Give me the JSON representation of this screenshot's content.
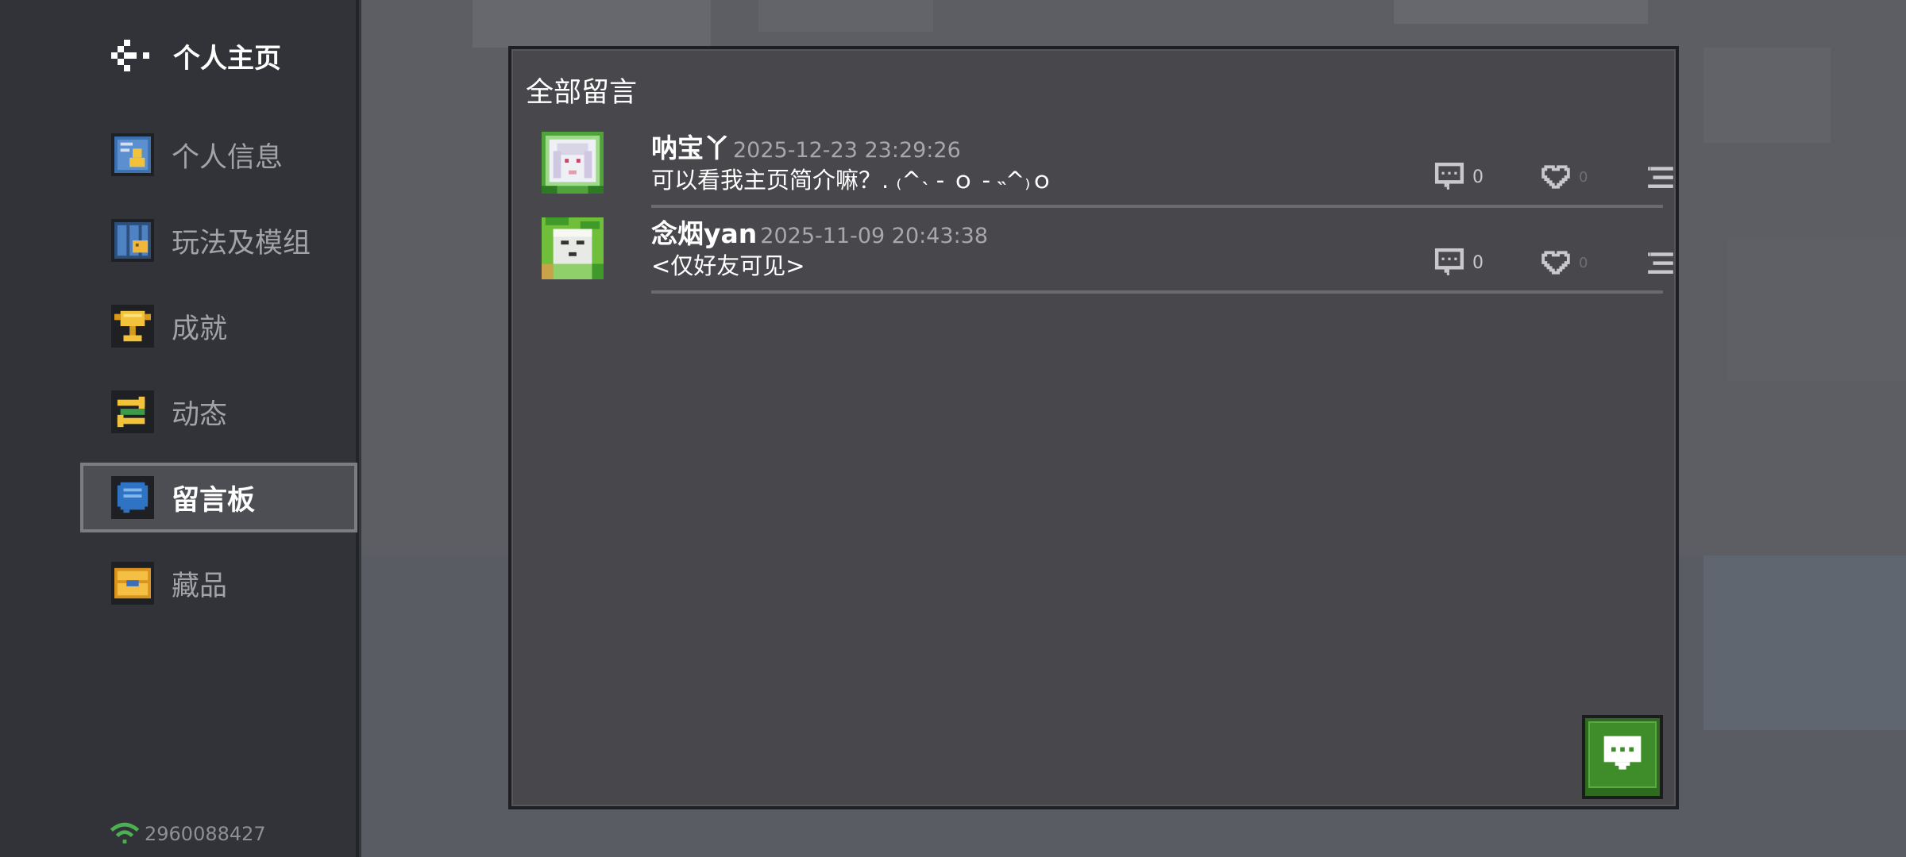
{
  "header": {
    "back_icon": "back-arrow-icon",
    "title": "个人主页"
  },
  "sidebar": {
    "items": [
      {
        "label": "个人信息",
        "icon": "profile-card-icon",
        "active": false
      },
      {
        "label": "玩法及模组",
        "icon": "mods-grid-icon",
        "active": false
      },
      {
        "label": "成就",
        "icon": "trophy-icon",
        "active": false
      },
      {
        "label": "动态",
        "icon": "feed-arrows-icon",
        "active": false
      },
      {
        "label": "留言板",
        "icon": "speech-bubble-icon",
        "active": true
      },
      {
        "label": "藏品",
        "icon": "chest-icon",
        "active": false
      }
    ]
  },
  "footer": {
    "connection_icon": "wifi-icon",
    "user_id": "2960088427"
  },
  "board": {
    "title": "全部留言",
    "messages": [
      {
        "name": "呐宝丫",
        "time": "2025-12-23 23:29:26",
        "text": "可以看我主页简介嘛？. ₍^˴ - ｏ - ˵^₎ｏ",
        "comments": "0",
        "likes": "0"
      },
      {
        "name": "念烟yan",
        "time": "2025-11-09 20:43:38",
        "text": "<仅好友可见>",
        "comments": "0",
        "likes": "0"
      }
    ],
    "post_button_icon": "comment-bubble-icon"
  },
  "colors": {
    "accent_green": "#3e8c2a",
    "sidebar_bg": "#313338",
    "panel_bg": "#48484c",
    "active_nav_bg": "#4c4e54"
  }
}
